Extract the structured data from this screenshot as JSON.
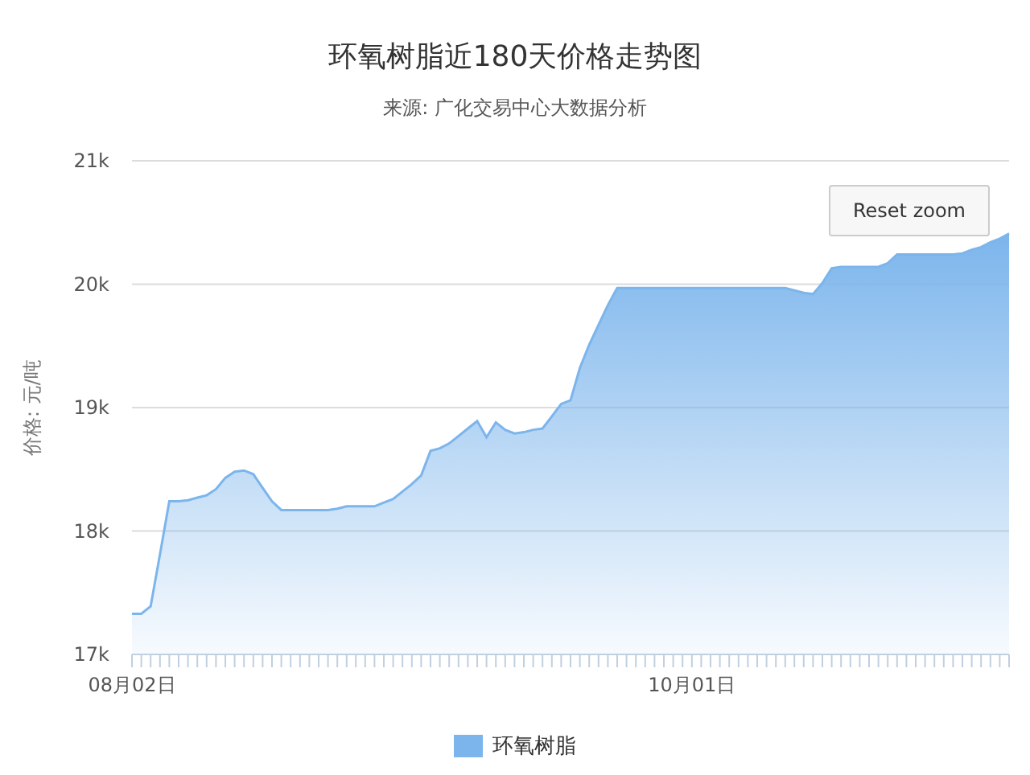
{
  "title": "环氧树脂近180天价格走势图",
  "subtitle": "来源: 广化交易中心大数据分析",
  "reset_button": "Reset zoom",
  "chart": {
    "chart_data": {
      "type": "area",
      "ylabel": "价格: 元/吨",
      "categories": [
        "08月02日",
        null,
        null,
        null,
        null,
        null,
        null,
        null,
        null,
        null,
        null,
        null,
        null,
        null,
        null,
        null,
        null,
        null,
        null,
        null,
        null,
        null,
        null,
        null,
        null,
        null,
        null,
        null,
        null,
        null,
        null,
        null,
        null,
        null,
        null,
        null,
        null,
        null,
        null,
        null,
        null,
        null,
        null,
        null,
        null,
        null,
        null,
        null,
        null,
        null,
        null,
        null,
        null,
        null,
        null,
        null,
        null,
        null,
        null,
        null,
        "10月01日",
        null,
        null,
        null,
        null,
        null,
        null,
        null,
        null,
        null,
        null,
        null,
        null,
        null,
        null,
        null,
        null,
        null,
        null,
        null,
        null,
        null,
        null,
        null,
        null,
        null,
        null,
        null,
        null,
        null,
        null,
        null,
        null,
        null,
        null
      ],
      "series": [
        {
          "name": "环氧树脂",
          "color": "#7cb5ec",
          "values": [
            17330,
            17330,
            17390,
            17810,
            18240,
            18240,
            18250,
            18270,
            18290,
            18340,
            18430,
            18480,
            18490,
            18460,
            18350,
            18240,
            18170,
            18170,
            18170,
            18170,
            18170,
            18170,
            18180,
            18200,
            18200,
            18200,
            18200,
            18230,
            18260,
            18320,
            18380,
            18450,
            18650,
            18670,
            18710,
            18770,
            18830,
            18890,
            18760,
            18880,
            18820,
            18790,
            18800,
            18820,
            18830,
            18930,
            19030,
            19060,
            19320,
            19510,
            19670,
            19830,
            19970,
            19970,
            19970,
            19970,
            19970,
            19970,
            19970,
            19970,
            19970,
            19970,
            19970,
            19970,
            19970,
            19970,
            19970,
            19970,
            19970,
            19970,
            19970,
            19950,
            19930,
            19920,
            20010,
            20130,
            20140,
            20140,
            20140,
            20140,
            20140,
            20170,
            20240,
            20240,
            20240,
            20240,
            20240,
            20240,
            20240,
            20250,
            20280,
            20300,
            20340,
            20370,
            20410
          ]
        }
      ],
      "ylim": [
        17000,
        21000
      ],
      "grid": true,
      "yticks": [
        {
          "value": 17000,
          "label": "17k"
        },
        {
          "value": 18000,
          "label": "18k"
        },
        {
          "value": 19000,
          "label": "19k"
        },
        {
          "value": 20000,
          "label": "20k"
        },
        {
          "value": 21000,
          "label": "21k"
        }
      ]
    }
  }
}
